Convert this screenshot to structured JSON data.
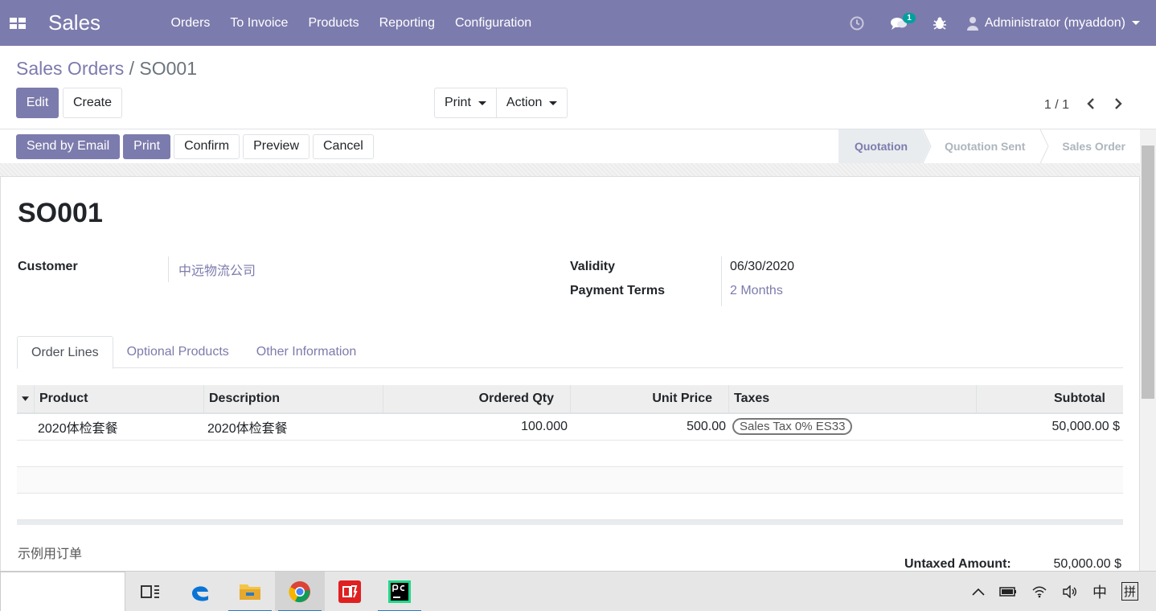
{
  "topbar": {
    "app_name": "Sales",
    "menu": [
      "Orders",
      "To Invoice",
      "Products",
      "Reporting",
      "Configuration"
    ],
    "messages_badge": "1",
    "user": "Administrator (myaddon)",
    "icons": [
      "apps-icon",
      "clock-icon",
      "chat-icon",
      "bug-icon",
      "user-icon"
    ]
  },
  "breadcrumb": {
    "parent": "Sales Orders",
    "separator": " / ",
    "current": "SO001"
  },
  "control": {
    "edit_label": "Edit",
    "create_label": "Create",
    "print_label": "Print",
    "action_label": "Action",
    "pager": "1 / 1"
  },
  "statusbar": {
    "buttons": {
      "send_email": "Send by Email",
      "print": "Print",
      "confirm": "Confirm",
      "preview": "Preview",
      "cancel": "Cancel"
    },
    "stages": [
      "Quotation",
      "Quotation Sent",
      "Sales Order"
    ],
    "current_stage": "Quotation"
  },
  "form": {
    "title": "SO001",
    "customer_label": "Customer",
    "customer_value": "中远物流公司",
    "validity_label": "Validity",
    "validity_value": "06/30/2020",
    "payment_terms_label": "Payment Terms",
    "payment_terms_value": "2 Months"
  },
  "tabs": [
    "Order Lines",
    "Optional Products",
    "Other Information"
  ],
  "order_lines": {
    "headers": {
      "product": "Product",
      "description": "Description",
      "qty": "Ordered Qty",
      "unit_price": "Unit Price",
      "taxes": "Taxes",
      "subtotal": "Subtotal"
    },
    "rows": [
      {
        "product": "2020体检套餐",
        "description": "2020体检套餐",
        "qty": "100.000",
        "unit_price": "500.00",
        "taxes": "Sales Tax 0% ES33",
        "subtotal": "50,000.00 $"
      }
    ]
  },
  "note": "示例用订单",
  "totals": {
    "untaxed_label": "Untaxed Amount:",
    "untaxed_value": "50,000.00 $"
  },
  "taskbar": {
    "ime_lang": "中",
    "ime_mode": "拼"
  },
  "colors": {
    "brand": "#7c7bad",
    "link": "#7c7bad"
  }
}
